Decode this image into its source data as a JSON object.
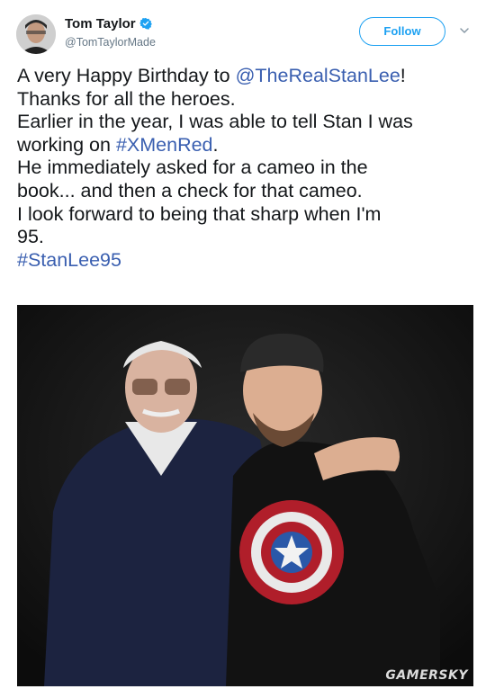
{
  "user": {
    "name": "Tom Taylor",
    "handle": "@TomTaylorMade"
  },
  "actions": {
    "follow_label": "Follow"
  },
  "tweet": {
    "l1a": "A very Happy Birthday to ",
    "l1_mention": "@TheRealStanLee",
    "l1b": "!",
    "l2": "Thanks for all the heroes.",
    "l3": "Earlier in the year, I was able to tell Stan I was",
    "l4a": "working on ",
    "l4_hashtag": "#XMenRed",
    "l4b": ".",
    "l5": "He immediately asked for a cameo in the",
    "l6": "book... and then a check for that cameo.",
    "l7": "I look forward to being that sharp when I'm",
    "l8": "95.",
    "l9_hashtag": "#StanLee95"
  },
  "photo": {
    "watermark": "GAMERSKY"
  },
  "colors": {
    "link": "#3a5fb0",
    "follow": "#1da1f2",
    "verified": "#1da1f2"
  }
}
